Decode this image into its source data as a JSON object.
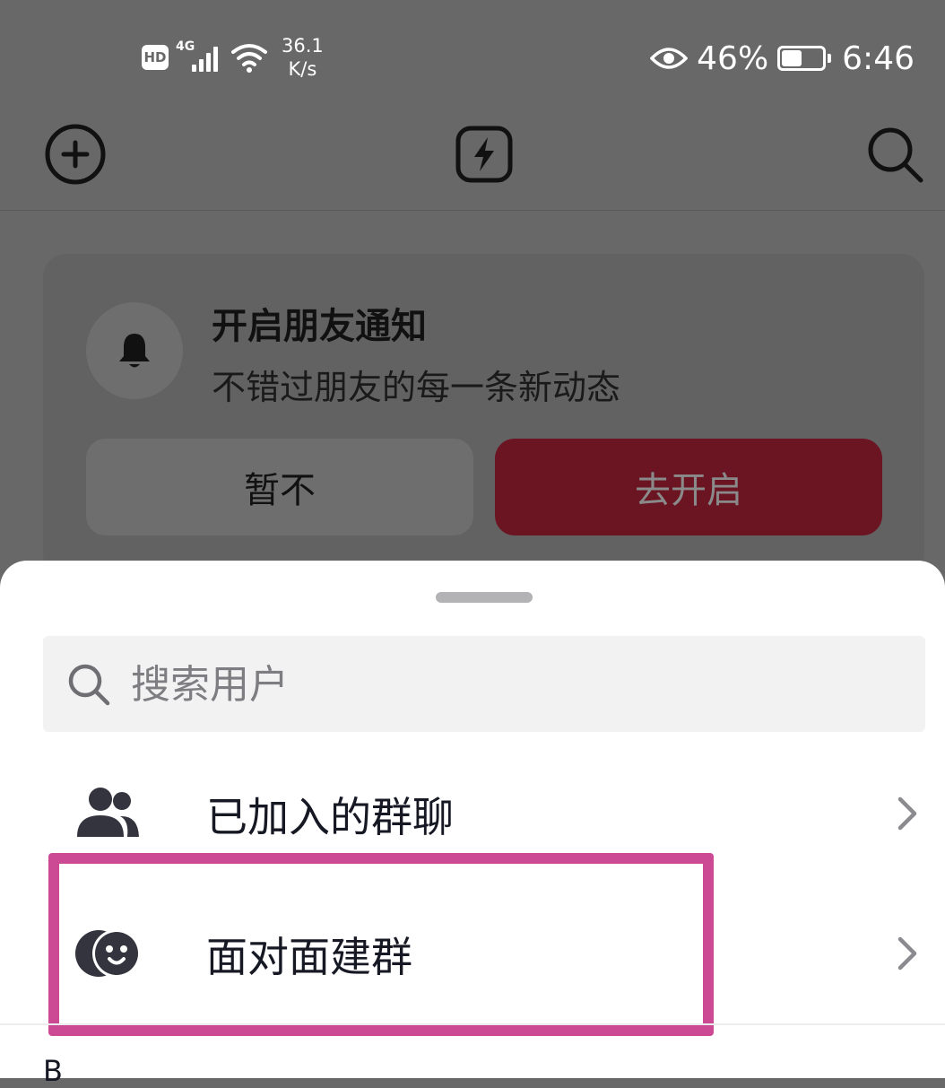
{
  "status_bar": {
    "hd": "HD",
    "network": "4G",
    "speed_value": "36.1",
    "speed_unit": "K/s",
    "battery_percent": "46%",
    "time": "6:46"
  },
  "top_bar": {
    "left_icon": "add-circle-icon",
    "center_icon": "lightning-icon",
    "right_icon": "search-icon"
  },
  "notify_card": {
    "icon": "bell-icon",
    "title": "开启朋友通知",
    "subtitle": "不错过朋友的每一条新动态",
    "later_label": "暂不",
    "enable_label": "去开启"
  },
  "sheet": {
    "search": {
      "placeholder": "搜索用户",
      "value": ""
    },
    "items": [
      {
        "icon": "group-icon",
        "label": "已加入的群聊"
      },
      {
        "icon": "face-to-face-icon",
        "label": "面对面建群"
      }
    ],
    "section_letter": "B"
  },
  "colors": {
    "accent": "#fe2c55",
    "highlight_frame": "#cc4a94",
    "overlay": "#686868"
  }
}
